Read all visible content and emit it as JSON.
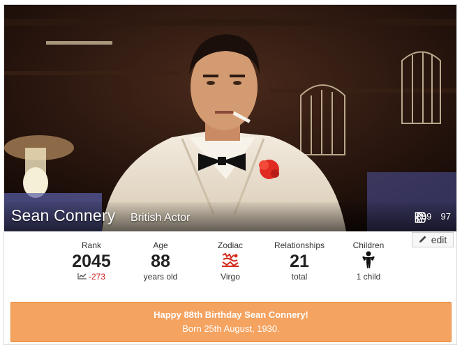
{
  "profile": {
    "name": "Sean Connery",
    "description": "British Actor",
    "likes": "309",
    "dislikes": "97",
    "edit_label": "edit"
  },
  "stats": {
    "rank": {
      "label": "Rank",
      "value": "2045",
      "change": "-273"
    },
    "age": {
      "label": "Age",
      "value": "88",
      "sub": "years old"
    },
    "zodiac": {
      "label": "Zodiac",
      "sub": "Virgo",
      "icon": "virgo-zodiac-icon"
    },
    "relationships": {
      "label": "Relationships",
      "value": "21",
      "sub": "total"
    },
    "children": {
      "label": "Children",
      "sub": "1 child",
      "icon": "child-icon"
    }
  },
  "birthday": {
    "line1": "Happy 88th Birthday Sean Connery!",
    "line2": "Born 25th August, 1930."
  },
  "colors": {
    "banner": "#f5a361",
    "rank_down": "#cc1f1f",
    "zodiac": "#d42b1e"
  }
}
